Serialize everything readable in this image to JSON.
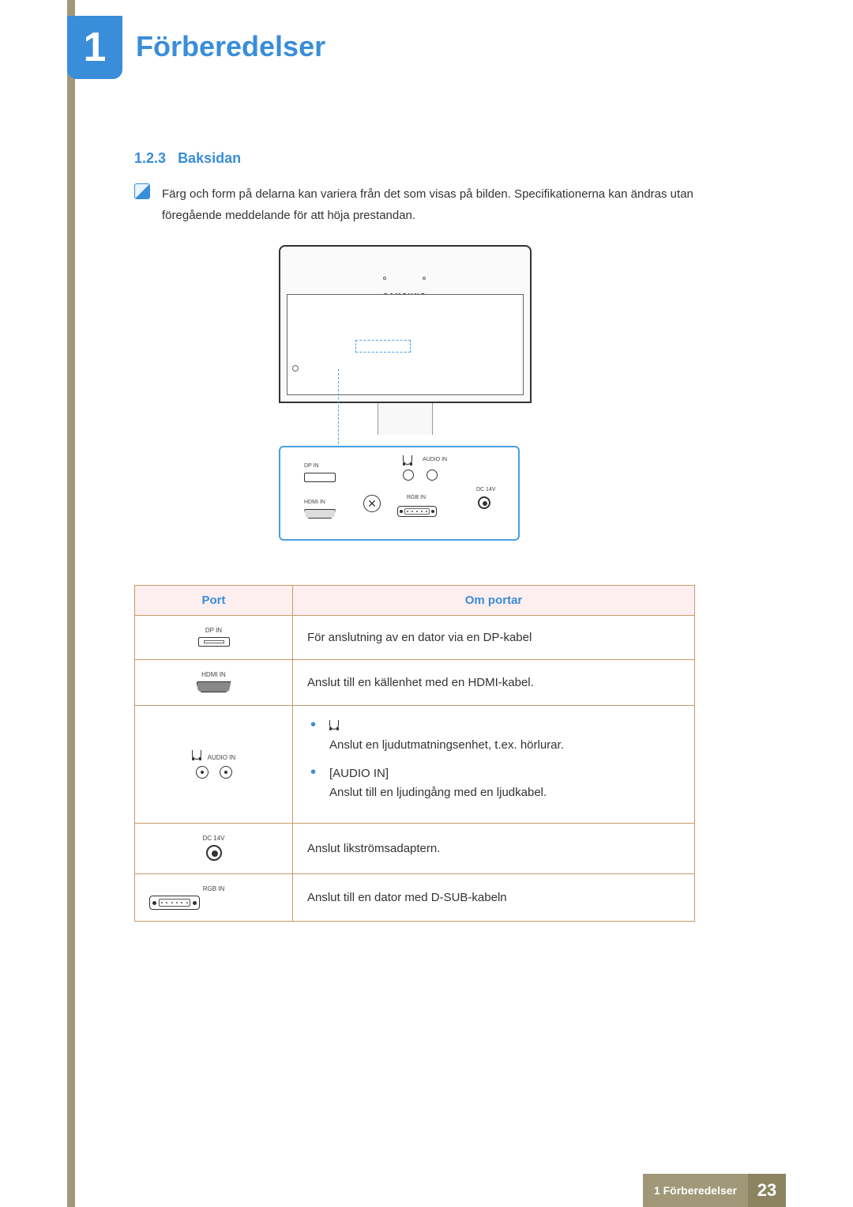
{
  "chapter": {
    "number": "1",
    "title": "Förberedelser"
  },
  "section": {
    "number": "1.2.3",
    "title": "Baksidan"
  },
  "note": "Färg och form på delarna kan variera från det som visas på bilden. Specifikationerna kan ändras utan föregående meddelande för att höja prestandan.",
  "diagram": {
    "brand": "SAMSUNG",
    "labels": {
      "dp_in": "DP IN",
      "hdmi_in": "HDMI IN",
      "audio_in": "AUDIO IN",
      "rgb_in": "RGB IN",
      "dc_14v": "DC 14V"
    }
  },
  "table": {
    "headers": {
      "port": "Port",
      "desc": "Om portar"
    },
    "rows": [
      {
        "icon_label": "DP IN",
        "desc_text": "För anslutning av en dator via en DP-kabel"
      },
      {
        "icon_label": "HDMI IN",
        "desc_text": "Anslut till en källenhet med en HDMI-kabel."
      },
      {
        "icon_label": "AUDIO IN",
        "desc_headphone": "Anslut en ljudutmatningsenhet, t.ex. hörlurar.",
        "desc_audio_label": "[AUDIO IN]",
        "desc_audio": "Anslut till en ljudingång med en ljudkabel."
      },
      {
        "icon_label": "DC 14V",
        "desc_text": "Anslut likströmsadaptern."
      },
      {
        "icon_label": "RGB IN",
        "desc_text": "Anslut till en dator med D-SUB-kabeln"
      }
    ]
  },
  "footer": {
    "label": "1 Förberedelser",
    "page": "23"
  }
}
